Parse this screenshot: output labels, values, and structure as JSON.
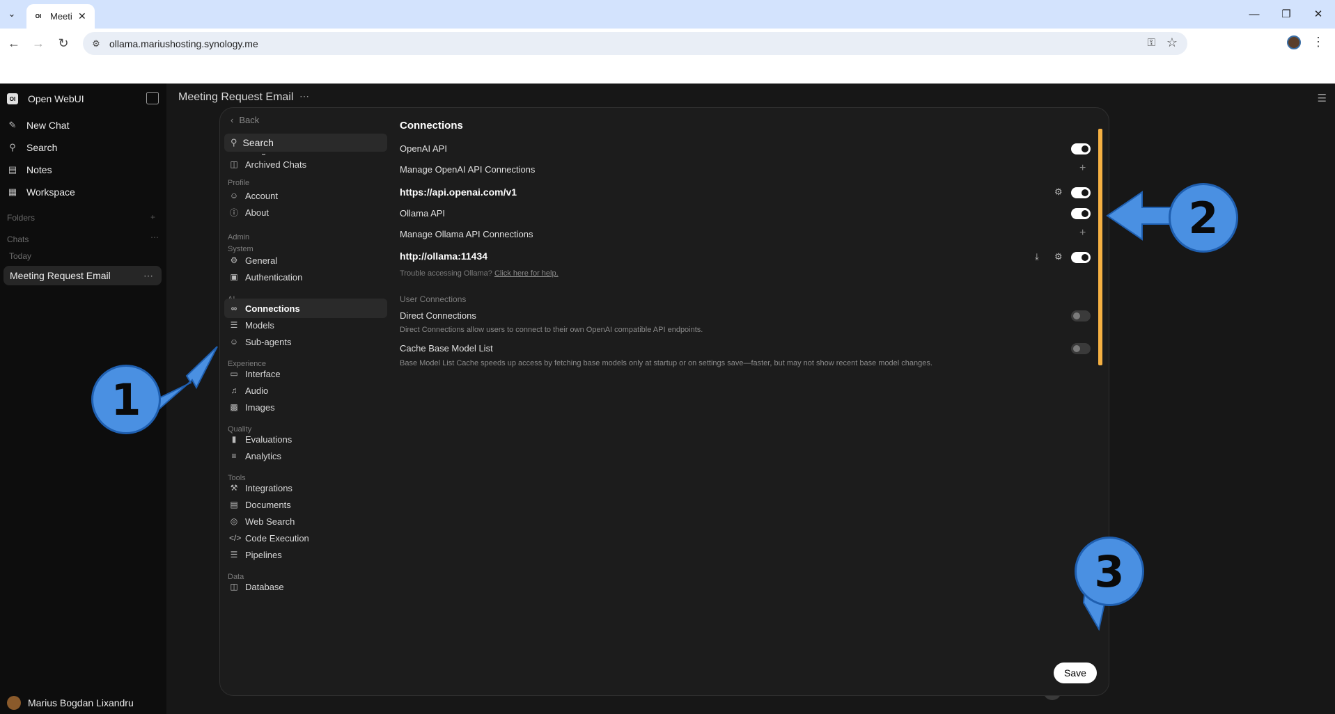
{
  "browser": {
    "tab_title": "Meeti",
    "tab_favicon": "OI",
    "url": "ollama.mariushosting.synology.me"
  },
  "app": {
    "name": "Open WebUI",
    "logo": "OI",
    "sidebar": {
      "new_chat": "New Chat",
      "search": "Search",
      "notes": "Notes",
      "workspace": "Workspace",
      "folders": "Folders",
      "chats": "Chats",
      "today": "Today",
      "chat_item": "Meeting Request Email",
      "user": "Marius Bogdan Lixandru"
    },
    "chat_title": "Meeting Request Email"
  },
  "settings": {
    "back": "Back",
    "search": "Search",
    "nav": {
      "archived_chats": "Archived Chats",
      "profile_section": "Profile",
      "account": "Account",
      "about": "About",
      "admin_section": "Admin",
      "system_section": "System",
      "general": "General",
      "authentication": "Authentication",
      "ai_section": "AI",
      "connections": "Connections",
      "models": "Models",
      "sub_agents": "Sub-agents",
      "experience_section": "Experience",
      "interface": "Interface",
      "audio": "Audio",
      "images": "Images",
      "quality_section": "Quality",
      "evaluations": "Evaluations",
      "analytics": "Analytics",
      "tools_section": "Tools",
      "integrations": "Integrations",
      "documents": "Documents",
      "web_search": "Web Search",
      "code_execution": "Code Execution",
      "pipelines": "Pipelines",
      "data_section": "Data",
      "database": "Database"
    },
    "panel": {
      "title": "Connections",
      "openai_api": "OpenAI API",
      "manage_openai": "Manage OpenAI API Connections",
      "openai_url": "https://api.openai.com/v1",
      "ollama_api": "Ollama API",
      "manage_ollama": "Manage Ollama API Connections",
      "ollama_url": "http://ollama:11434",
      "help_text": "Trouble accessing Ollama?",
      "help_link": "Click here for help.",
      "user_connections": "User Connections",
      "direct_connections": "Direct Connections",
      "direct_desc": "Direct Connections allow users to connect to their own OpenAI compatible API endpoints.",
      "cache_base_model": "Cache Base Model List",
      "cache_desc": "Base Model List Cache speeds up access by fetching base models only at startup or on settings save—faster, but may not show recent base model changes.",
      "toggles": {
        "openai_api": true,
        "openai_connection": true,
        "ollama_api": true,
        "ollama_connection": true,
        "direct_connections": false,
        "cache_base_model": false
      }
    },
    "save": "Save"
  },
  "annotations": {
    "badge1": "1",
    "badge2": "2",
    "badge3": "3",
    "color": "#4a90e2"
  }
}
